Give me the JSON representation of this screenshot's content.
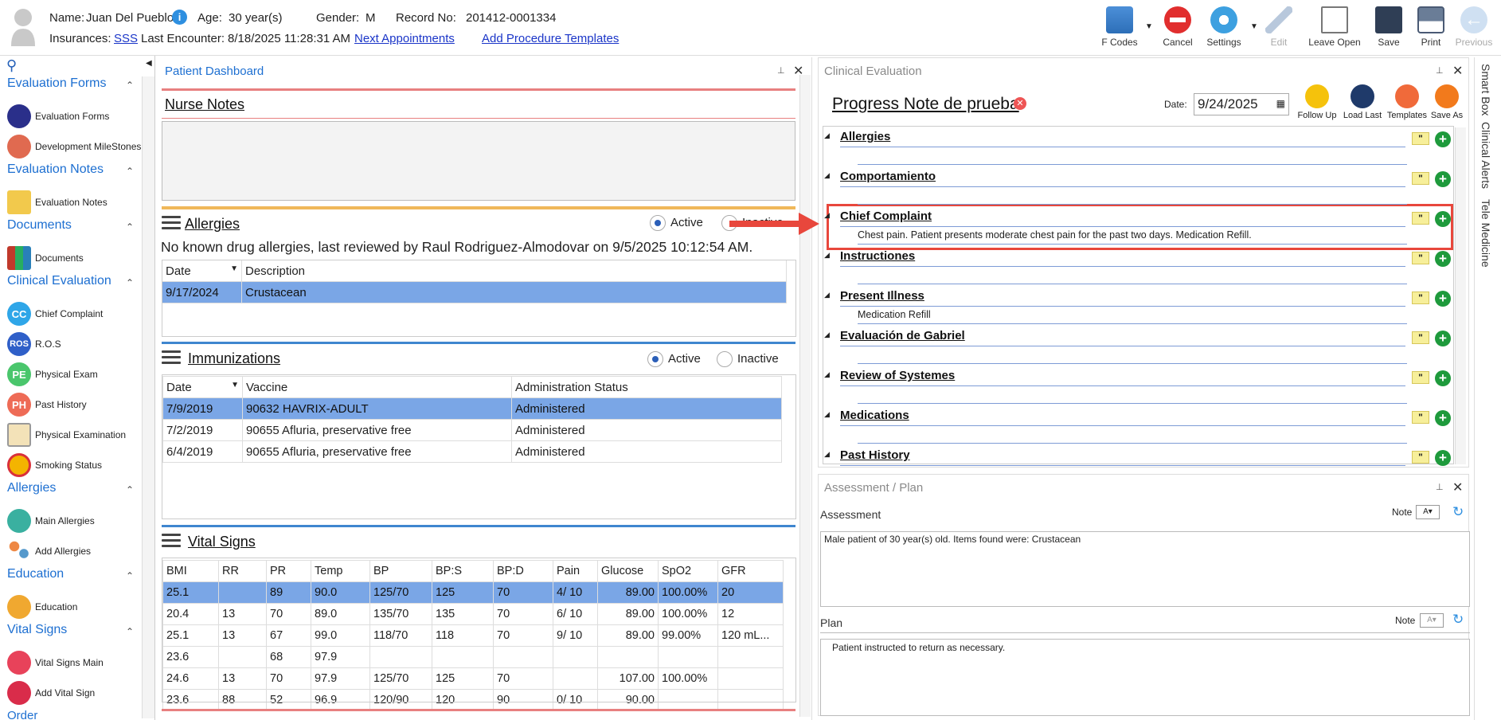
{
  "patient": {
    "name_label": "Name:",
    "name": "Juan Del Pueblo",
    "age_label": "Age:",
    "age": "30 year(s)",
    "gender_label": "Gender:",
    "gender": "M",
    "record_label": "Record No:",
    "record": "201412-0001334",
    "insurances_label": "Insurances:",
    "insurance": "SSS",
    "last_encounter_label": "Last Encounter:",
    "last_encounter": "8/18/2025 11:28:31 AM",
    "next_appointments": "Next Appointments",
    "add_procedure_templates": "Add Procedure Templates"
  },
  "toolbar": [
    {
      "label": "F Codes",
      "icon": "fcodes-icon"
    },
    {
      "label": "Cancel",
      "icon": "cancel-icon"
    },
    {
      "label": "Settings",
      "icon": "gear-icon"
    },
    {
      "label": "Edit",
      "icon": "pencil-icon"
    },
    {
      "label": "Leave Open",
      "icon": "leave-open-icon"
    },
    {
      "label": "Save",
      "icon": "save-icon"
    },
    {
      "label": "Print",
      "icon": "print-icon"
    },
    {
      "label": "Previous",
      "icon": "back-arrow-icon"
    }
  ],
  "sidebar": {
    "sections": [
      {
        "title": "Evaluation Forms",
        "items": [
          "Evaluation Forms",
          "Development MileStones"
        ]
      },
      {
        "title": "Evaluation Notes",
        "items": [
          "Evaluation Notes"
        ]
      },
      {
        "title": "Documents",
        "items": [
          "Documents"
        ]
      },
      {
        "title": "Clinical Evaluation",
        "items": [
          "Chief Complaint",
          "R.O.S",
          "Physical Exam",
          "Past History",
          "Physical Examination",
          "Smoking Status"
        ]
      },
      {
        "title": "Allergies",
        "items": [
          "Main Allergies",
          "Add Allergies"
        ]
      },
      {
        "title": "Education",
        "items": [
          "Education"
        ]
      },
      {
        "title": "Vital Signs",
        "items": [
          "Vital Signs Main",
          "Add Vital Sign"
        ]
      },
      {
        "title": "Order",
        "items": []
      }
    ],
    "badges": {
      "cc": "CC",
      "ros": "ROS",
      "pe": "PE",
      "ph": "PH"
    }
  },
  "dashboard": {
    "title": "Patient Dashboard",
    "nurse_notes": "Nurse Notes",
    "allergies": {
      "title": "Allergies",
      "active": "Active",
      "inactive": "Inactive",
      "summary": "No known drug allergies, last reviewed by Raul Rodriguez-Almodovar on 9/5/2025 10:12:54 AM.",
      "columns": [
        "Date",
        "Description"
      ],
      "rows": [
        [
          "9/17/2024",
          "Crustacean"
        ]
      ]
    },
    "immunizations": {
      "title": "Immunizations",
      "active": "Active",
      "inactive": "Inactive",
      "columns": [
        "Date",
        "Vaccine",
        "Administration Status"
      ],
      "rows": [
        [
          "7/9/2019",
          "90632 HAVRIX-ADULT",
          "Administered"
        ],
        [
          "7/2/2019",
          "90655 Afluria, preservative free",
          "Administered"
        ],
        [
          "6/4/2019",
          "90655 Afluria, preservative free",
          "Administered"
        ]
      ]
    },
    "vitals": {
      "title": "Vital Signs",
      "columns": [
        "BMI",
        "RR",
        "PR",
        "Temp",
        "BP",
        "BP:S",
        "BP:D",
        "Pain",
        "Glucose",
        "SpO2",
        "GFR"
      ],
      "rows": [
        [
          "25.1",
          "",
          "89",
          "90.0",
          "125/70",
          "125",
          "70",
          "4/ 10",
          "89.00",
          "100.00%",
          "20"
        ],
        [
          "20.4",
          "13",
          "70",
          "89.0",
          "135/70",
          "135",
          "70",
          "6/ 10",
          "89.00",
          "100.00%",
          "12"
        ],
        [
          "25.1",
          "13",
          "67",
          "99.0",
          "118/70",
          "118",
          "70",
          "9/ 10",
          "89.00",
          "99.00%",
          "120 mL..."
        ],
        [
          "23.6",
          "",
          "68",
          "97.9",
          "",
          "",
          "",
          "",
          "",
          "",
          ""
        ],
        [
          "24.6",
          "13",
          "70",
          "97.9",
          "125/70",
          "125",
          "70",
          "",
          "107.00",
          "100.00%",
          ""
        ],
        [
          "23.6",
          "88",
          "52",
          "96.9",
          "120/90",
          "120",
          "90",
          "0/ 10",
          "90.00",
          "",
          ""
        ]
      ]
    }
  },
  "clinical": {
    "title": "Clinical Evaluation",
    "note_title": "Progress Note de prueba",
    "date_label": "Date:",
    "date": "9/24/2025",
    "actions": [
      "Follow Up",
      "Load Last",
      "Templates",
      "Save As"
    ],
    "sections": [
      {
        "title": "Allergies",
        "content": ""
      },
      {
        "title": "Comportamiento",
        "content": ""
      },
      {
        "title": "Chief Complaint",
        "content": "Chest pain. Patient presents moderate chest pain for the past two days. Medication Refill."
      },
      {
        "title": "Instructiones",
        "content": ""
      },
      {
        "title": "Present Illness",
        "content": "Medication Refill"
      },
      {
        "title": "Evaluación de Gabriel",
        "content": ""
      },
      {
        "title": "Review of Systemes",
        "content": ""
      },
      {
        "title": "Medications",
        "content": ""
      },
      {
        "title": "Past History",
        "content": ""
      }
    ]
  },
  "assessment": {
    "title": "Assessment / Plan",
    "assessment_label": "Assessment",
    "note_label": "Note",
    "assessment_text": "Male patient of 30 year(s) old. Items found were:  Crustacean",
    "plan_label": "Plan",
    "plan_text": "Patient instructed to return as necessary."
  },
  "right_tabs": [
    "Smart Box",
    "Clinical Alerts",
    "Tele Medicine"
  ],
  "colors": {
    "accent": "#1d6fd1",
    "selected_row": "#7aa6e6",
    "callout": "#e8473c",
    "nurse_divider": "#e88080",
    "allergy_divider": "#f0b85a",
    "blue_divider": "#3f86cf"
  }
}
